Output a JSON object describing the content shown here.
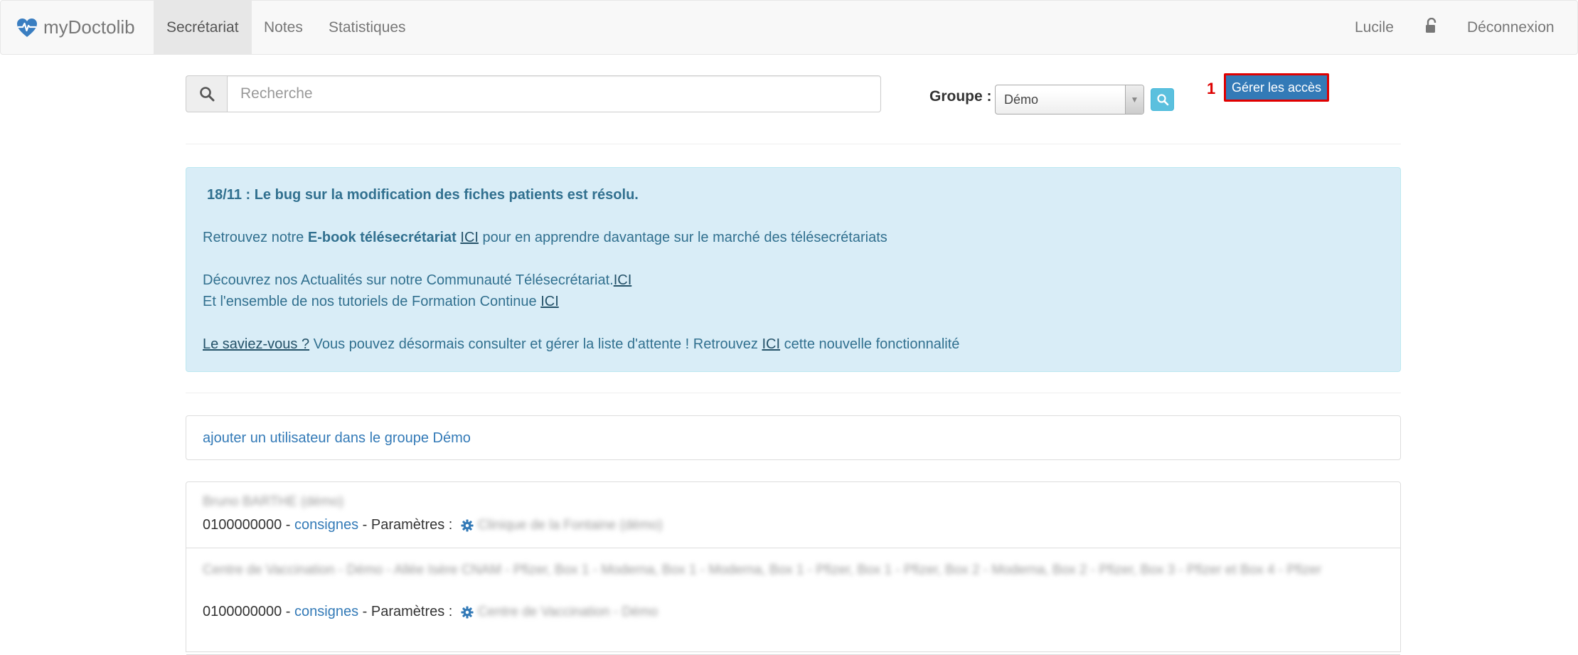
{
  "navbar": {
    "brand": "myDoctolib",
    "items": [
      {
        "label": "Secrétariat",
        "active": true
      },
      {
        "label": "Notes",
        "active": false
      },
      {
        "label": "Statistiques",
        "active": false
      }
    ],
    "user": "Lucile",
    "logout": "Déconnexion"
  },
  "search": {
    "placeholder": "Recherche",
    "value": ""
  },
  "group": {
    "label": "Groupe :",
    "selected": "Démo"
  },
  "manage_access": {
    "annotation": "1",
    "label": "Gérer les accès"
  },
  "alert": {
    "headline": "18/11 : Le bug sur la modification des fiches patients est résolu.",
    "ebook_pre": "Retrouvez notre ",
    "ebook_bold": "E-book télésecrétariat",
    "ebook_link": "ICI",
    "ebook_post": " pour en apprendre davantage sur le marché des télésecrétariats",
    "news_text": "Découvrez nos Actualités sur notre Communauté Télésecrétariat.",
    "news_link": "ICI",
    "tuto_text": "Et l'ensemble de nos tutoriels de Formation Continue ",
    "tuto_link": "ICI",
    "saviez_link": "Le saviez-vous ?",
    "saviez_text": " Vous pouvez désormais consulter et gérer la liste d'attente ! Retrouvez ",
    "saviez_link2": "ICI",
    "saviez_post": " cette nouvelle fonctionnalité"
  },
  "add_user": {
    "label": "ajouter un utilisateur dans le groupe Démo"
  },
  "entries": [
    {
      "name": "Bruno BARTHE (démo)",
      "phone": "0100000000",
      "sep1": " - ",
      "consignes": "consignes",
      "params_label": " - Paramètres : ",
      "param_value": "Clinique de la Fontaine (démo)"
    },
    {
      "name": "Centre de Vaccination - Démo - Allée Isère CNAM - Pfizer, Box 1 - Moderna, Box 1 - Moderna, Box 1 - Pfizer, Box 1 - Pfizer, Box 2 - Moderna, Box 2 - Pfizer, Box 3 - Pfizer et Box 4 - Pfizer",
      "phone": "0100000000",
      "sep1": " - ",
      "consignes": "consignes",
      "params_label": " - Paramètres : ",
      "param_value": "Centre de Vaccination - Démo"
    }
  ]
}
